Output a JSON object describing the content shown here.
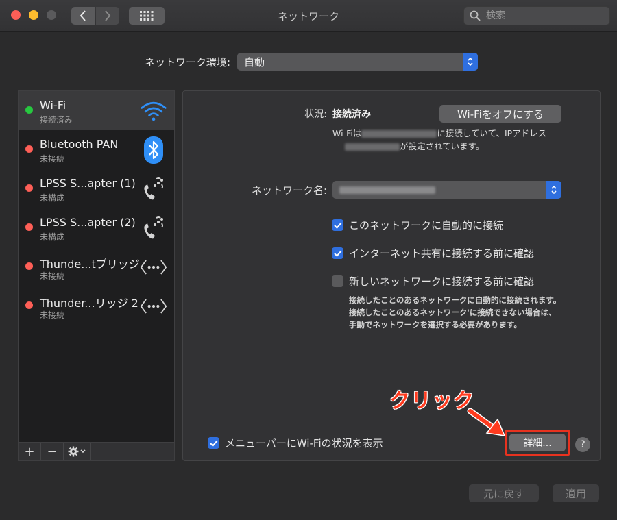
{
  "window": {
    "title": "ネットワーク"
  },
  "search": {
    "placeholder": "検索"
  },
  "location": {
    "label": "ネットワーク環境:",
    "value": "自動"
  },
  "sidebar": {
    "services": [
      {
        "name": "Wi-Fi",
        "status": "接続済み",
        "dot": "#27c840",
        "icon": "wifi-icon"
      },
      {
        "name": "Bluetooth PAN",
        "status": "未接続",
        "dot": "#fe5f57",
        "icon": "bluetooth-icon"
      },
      {
        "name": "LPSS S...apter (1)",
        "status": "未構成",
        "dot": "#fe5f57",
        "icon": "phone-icon"
      },
      {
        "name": "LPSS S...apter (2)",
        "status": "未構成",
        "dot": "#fe5f57",
        "icon": "phone-icon"
      },
      {
        "name": "Thunde...tブリッジ",
        "status": "未接続",
        "dot": "#fe5f57",
        "icon": "bridge-icon"
      },
      {
        "name": "Thunder...リッジ 2",
        "status": "未接続",
        "dot": "#fe5f57",
        "icon": "bridge-icon"
      }
    ],
    "tools": {
      "add": "+",
      "remove": "−"
    }
  },
  "detail": {
    "status_label": "状況:",
    "status_value": "接続済み",
    "wifi_off_button": "Wi-Fiをオフにする",
    "status_desc_1": "Wi-Fiは",
    "status_desc_2": "に接続していて、IPアドレス",
    "status_desc_3": "が設定されています。",
    "network_name_label": "ネットワーク名:",
    "auto_join": {
      "label": "このネットワークに自動的に接続",
      "checked": true
    },
    "ask_hotspot": {
      "label": "インターネット共有に接続する前に確認",
      "checked": true
    },
    "ask_new": {
      "label": "新しいネットワークに接続する前に確認",
      "checked": false
    },
    "ask_new_note": "接続したことのあるネットワークに自動的に接続されます。接続したことのあるネットワーク'に接続できない場合は、手動でネットワークを選択する必要があります。",
    "show_menubar": {
      "label": "メニューバーにWi-Fiの状況を表示",
      "checked": true
    },
    "advanced_button": "詳細...",
    "help_button": "?"
  },
  "annotation": {
    "text": "クリック",
    "color": "#ff3b1f"
  },
  "footer": {
    "revert_button": "元に戻す",
    "apply_button": "適用"
  },
  "colors": {
    "accent": "#2f6fdf",
    "connected": "#27c840",
    "disconnected": "#fe5f57",
    "highlight": "#e8321f"
  }
}
